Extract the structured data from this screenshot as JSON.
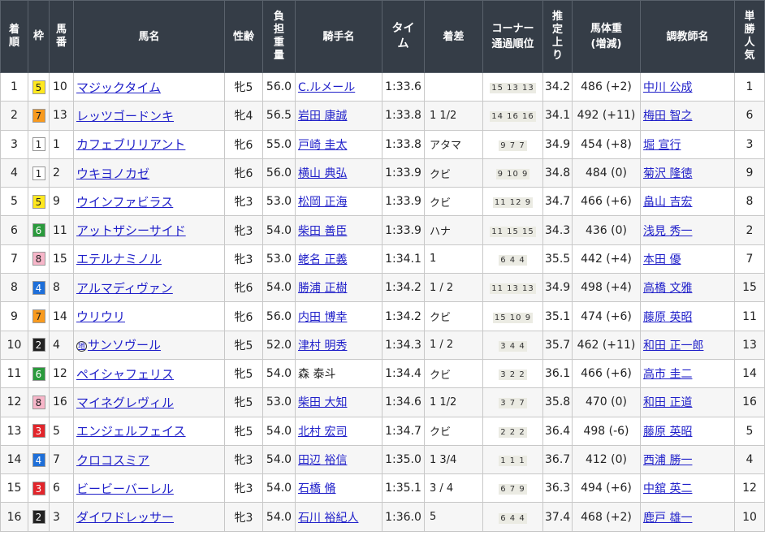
{
  "columns": [
    "着順",
    "枠",
    "馬番",
    "馬名",
    "性齢",
    "負担重量",
    "騎手名",
    "タイム",
    "着差",
    "コーナー通過順位",
    "推定上り",
    "馬体重(増減)",
    "調教師名",
    "単勝人気"
  ],
  "waku_colors": {
    "1": {
      "bg": "#ffffff",
      "fg": "#222222"
    },
    "2": {
      "bg": "#222222",
      "fg": "#ffffff"
    },
    "3": {
      "bg": "#e2252b",
      "fg": "#ffffff"
    },
    "4": {
      "bg": "#1e6fd9",
      "fg": "#ffffff"
    },
    "5": {
      "bg": "#ffe81f",
      "fg": "#222222"
    },
    "6": {
      "bg": "#2a9a3c",
      "fg": "#ffffff"
    },
    "7": {
      "bg": "#f89a1e",
      "fg": "#222222"
    },
    "8": {
      "bg": "#f7b6c9",
      "fg": "#222222"
    }
  },
  "rows": [
    {
      "rank": "1",
      "waku": "5",
      "num": "10",
      "name": "マジックタイム",
      "chi": false,
      "sexage": "牝5",
      "weight": "56.0",
      "jockey": "C.ルメール",
      "time": "1:33.6",
      "margin": "",
      "corner": "15 13 13",
      "last3f": "34.2",
      "body": "486 (+2)",
      "trainer": "中川 公成",
      "pop": "1"
    },
    {
      "rank": "2",
      "waku": "7",
      "num": "13",
      "name": "レッツゴードンキ",
      "chi": false,
      "sexage": "牝4",
      "weight": "56.5",
      "jockey": "岩田 康誠",
      "time": "1:33.8",
      "margin": "1 1/2",
      "corner": "14 16 16",
      "last3f": "34.1",
      "body": "492 (+11)",
      "trainer": "梅田 智之",
      "pop": "6"
    },
    {
      "rank": "3",
      "waku": "1",
      "num": "1",
      "name": "カフェブリリアント",
      "chi": false,
      "sexage": "牝6",
      "weight": "55.0",
      "jockey": "戸崎 圭太",
      "time": "1:33.8",
      "margin": "アタマ",
      "corner": "9 7 7",
      "last3f": "34.9",
      "body": "454 (+8)",
      "trainer": "堀 宣行",
      "pop": "3"
    },
    {
      "rank": "4",
      "waku": "1",
      "num": "2",
      "name": "ウキヨノカゼ",
      "chi": false,
      "sexage": "牝6",
      "weight": "56.0",
      "jockey": "横山 典弘",
      "time": "1:33.9",
      "margin": "クビ",
      "corner": "9 10 9",
      "last3f": "34.8",
      "body": "484 (0)",
      "trainer": "菊沢 隆徳",
      "pop": "9"
    },
    {
      "rank": "5",
      "waku": "5",
      "num": "9",
      "name": "ウインファビラス",
      "chi": false,
      "sexage": "牝3",
      "weight": "53.0",
      "jockey": "松岡 正海",
      "time": "1:33.9",
      "margin": "クビ",
      "corner": "11 12 9",
      "last3f": "34.7",
      "body": "466 (+6)",
      "trainer": "畠山 吉宏",
      "pop": "8"
    },
    {
      "rank": "6",
      "waku": "6",
      "num": "11",
      "name": "アットザシーサイド",
      "chi": false,
      "sexage": "牝3",
      "weight": "54.0",
      "jockey": "柴田 善臣",
      "time": "1:33.9",
      "margin": "ハナ",
      "corner": "11 15 15",
      "last3f": "34.3",
      "body": "436 (0)",
      "trainer": "浅見 秀一",
      "pop": "2"
    },
    {
      "rank": "7",
      "waku": "8",
      "num": "15",
      "name": "エテルナミノル",
      "chi": false,
      "sexage": "牝3",
      "weight": "53.0",
      "jockey": "蛯名 正義",
      "time": "1:34.1",
      "margin": "1",
      "corner": "6 4 4",
      "last3f": "35.5",
      "body": "442 (+4)",
      "trainer": "本田 優",
      "pop": "7"
    },
    {
      "rank": "8",
      "waku": "4",
      "num": "8",
      "name": "アルマディヴァン",
      "chi": false,
      "sexage": "牝6",
      "weight": "54.0",
      "jockey": "勝浦 正樹",
      "time": "1:34.2",
      "margin": "1 / 2",
      "corner": "11 13 13",
      "last3f": "34.9",
      "body": "498 (+4)",
      "trainer": "高橋 文雅",
      "pop": "15"
    },
    {
      "rank": "9",
      "waku": "7",
      "num": "14",
      "name": "ウリウリ",
      "chi": false,
      "sexage": "牝6",
      "weight": "56.0",
      "jockey": "内田 博幸",
      "time": "1:34.2",
      "margin": "クビ",
      "corner": "15 10 9",
      "last3f": "35.1",
      "body": "474 (+6)",
      "trainer": "藤原 英昭",
      "pop": "11"
    },
    {
      "rank": "10",
      "waku": "2",
      "num": "4",
      "name": "サンソヴール",
      "chi": true,
      "chi_label": "地",
      "sexage": "牝5",
      "weight": "52.0",
      "jockey": "津村 明秀",
      "time": "1:34.3",
      "margin": "1 / 2",
      "corner": "3 4 4",
      "last3f": "35.7",
      "body": "462 (+11)",
      "trainer": "和田 正一郎",
      "pop": "13"
    },
    {
      "rank": "11",
      "waku": "6",
      "num": "12",
      "name": "ペイシャフェリス",
      "chi": false,
      "sexage": "牝5",
      "weight": "54.0",
      "jockey": "森 泰斗",
      "jockey_plain": true,
      "time": "1:34.4",
      "margin": "クビ",
      "corner": "3 2 2",
      "last3f": "36.1",
      "body": "466 (+6)",
      "trainer": "高市 圭二",
      "pop": "14"
    },
    {
      "rank": "12",
      "waku": "8",
      "num": "16",
      "name": "マイネグレヴィル",
      "chi": false,
      "sexage": "牝5",
      "weight": "53.0",
      "jockey": "柴田 大知",
      "time": "1:34.6",
      "margin": "1 1/2",
      "corner": "3 7 7",
      "last3f": "35.8",
      "body": "470 (0)",
      "trainer": "和田 正道",
      "pop": "16"
    },
    {
      "rank": "13",
      "waku": "3",
      "num": "5",
      "name": "エンジェルフェイス",
      "chi": false,
      "sexage": "牝5",
      "weight": "54.0",
      "jockey": "北村 宏司",
      "time": "1:34.7",
      "margin": "クビ",
      "corner": "2 2 2",
      "last3f": "36.4",
      "body": "498 (-6)",
      "trainer": "藤原 英昭",
      "pop": "5"
    },
    {
      "rank": "14",
      "waku": "4",
      "num": "7",
      "name": "クロコスミア",
      "chi": false,
      "sexage": "牝3",
      "weight": "54.0",
      "jockey": "田辺 裕信",
      "time": "1:35.0",
      "margin": "1 3/4",
      "corner": "1 1 1",
      "last3f": "36.7",
      "body": "412 (0)",
      "trainer": "西浦 勝一",
      "pop": "4"
    },
    {
      "rank": "15",
      "waku": "3",
      "num": "6",
      "name": "ビービーバーレル",
      "chi": false,
      "sexage": "牝3",
      "weight": "54.0",
      "jockey": "石橋 脩",
      "time": "1:35.1",
      "margin": "3 / 4",
      "corner": "6 7 9",
      "last3f": "36.3",
      "body": "494 (+6)",
      "trainer": "中舘 英二",
      "pop": "12"
    },
    {
      "rank": "16",
      "waku": "2",
      "num": "3",
      "name": "ダイワドレッサー",
      "chi": false,
      "sexage": "牝3",
      "weight": "54.0",
      "jockey": "石川 裕紀人",
      "time": "1:36.0",
      "margin": "5",
      "corner": "6 4 4",
      "last3f": "37.4",
      "body": "468 (+2)",
      "trainer": "鹿戸 雄一",
      "pop": "10"
    }
  ]
}
